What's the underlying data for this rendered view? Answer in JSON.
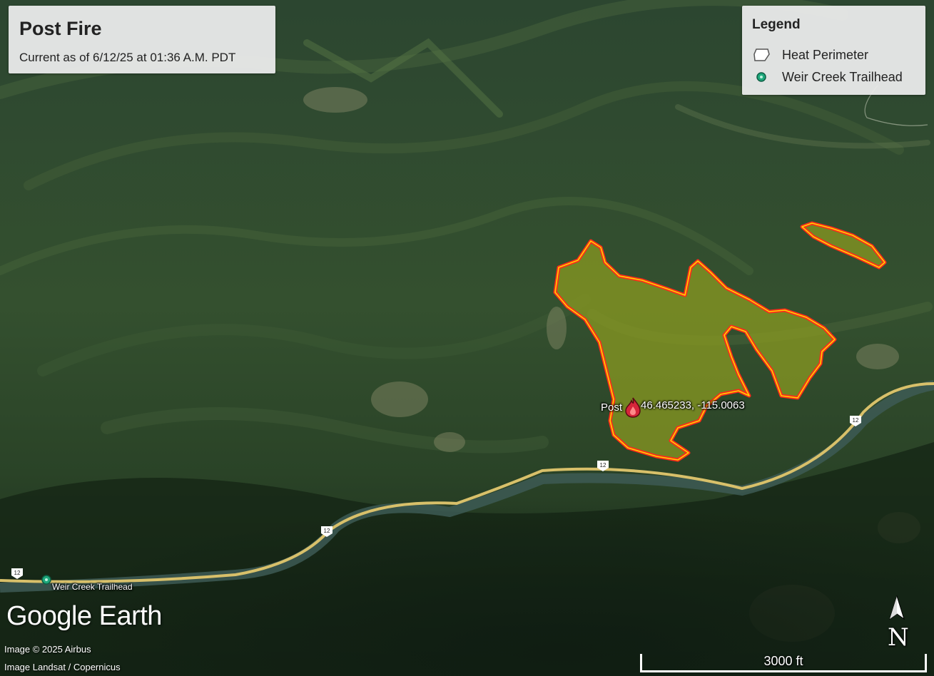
{
  "title": {
    "main": "Post Fire",
    "subtitle": "Current as of 6/12/25 at 01:36 A.M. PDT"
  },
  "legend": {
    "heading": "Legend",
    "items": [
      {
        "label": "Heat Perimeter",
        "icon": "polygon-outline-icon"
      },
      {
        "label": "Weir Creek Trailhead",
        "icon": "green-pin-icon",
        "color": "#1ea77b"
      }
    ]
  },
  "map": {
    "fire_label": "Post",
    "fire_coordinates": "46.465233, -115.0063",
    "trailhead_label": "Weir Creek Trailhead",
    "route_shields": [
      "12",
      "12",
      "12",
      "12"
    ],
    "perimeter_fill": "#8a9a22",
    "perimeter_outline": "#ff2a1a",
    "perimeter_inner": "#ffd400",
    "road_color": "#d8c06a"
  },
  "branding": {
    "logo": "Google Earth"
  },
  "credits": {
    "image": "Image © 2025 Airbus",
    "landsat": "Image Landsat / Copernicus"
  },
  "scale": {
    "label": "3000 ft"
  },
  "north_arrow": {
    "label": "N"
  }
}
